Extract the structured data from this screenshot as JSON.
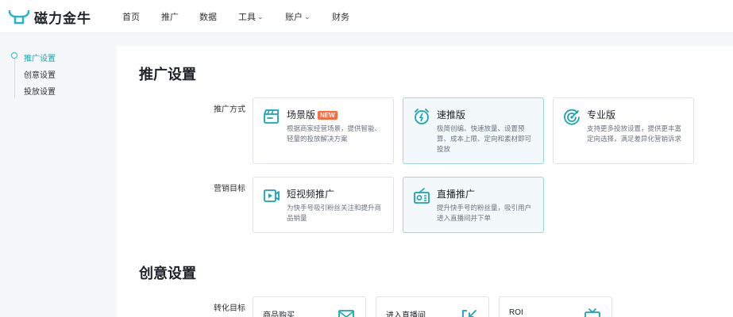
{
  "brand": {
    "name": "磁力金牛"
  },
  "nav": [
    {
      "label": "首页",
      "dropdown": false
    },
    {
      "label": "推广",
      "dropdown": false
    },
    {
      "label": "数据",
      "dropdown": false
    },
    {
      "label": "工具",
      "dropdown": true
    },
    {
      "label": "账户",
      "dropdown": true
    },
    {
      "label": "财务",
      "dropdown": false
    }
  ],
  "sidebar": {
    "items": [
      {
        "label": "推广设置",
        "active": true
      },
      {
        "label": "创意设置",
        "active": false
      },
      {
        "label": "投放设置",
        "active": false
      }
    ]
  },
  "promo_settings": {
    "title": "推广设置",
    "method_label": "推广方式",
    "methods": [
      {
        "title": "场景版",
        "badge": "NEW",
        "desc": [
          "根据商家经营场景，提供智能、",
          "轻量的投放解决方案"
        ],
        "icon": "clapperboard-icon",
        "selected": false
      },
      {
        "title": "速推版",
        "badge": "",
        "desc": [
          "极简创编、快速放量、设置预",
          "算、成本上限、定向和素材即可",
          "投放"
        ],
        "icon": "alarm-lightning-icon",
        "selected": true
      },
      {
        "title": "专业版",
        "badge": "",
        "desc": [
          "支持更多投放设置，提供更丰富",
          "定向选择，满足差异化营销诉求"
        ],
        "icon": "target-icon",
        "selected": false
      }
    ],
    "goal_label": "营销目标",
    "goals": [
      {
        "title": "短视频推广",
        "desc": [
          "为快手号吸引粉丝关注和提升商",
          "品销量"
        ],
        "icon": "video-icon",
        "selected": false
      },
      {
        "title": "直播推广",
        "desc": [
          "提升快手号的粉丝量，吸引用户",
          "进入直播间并下单"
        ],
        "icon": "live-radio-icon",
        "selected": true
      }
    ]
  },
  "creative_settings": {
    "title": "创意设置",
    "conversion_label": "转化目标",
    "targets": [
      {
        "title": "商品购买",
        "icon": "mail-icon"
      },
      {
        "title": "进入直播间",
        "icon": "enter-box-icon"
      },
      {
        "title": "ROI",
        "icon": "tv-icon"
      }
    ]
  },
  "colors": {
    "accent": "#1aa3b0",
    "badge": "#ff6a3d",
    "selected_bg": "#f3f9fb",
    "selected_border": "#9fd8de"
  }
}
